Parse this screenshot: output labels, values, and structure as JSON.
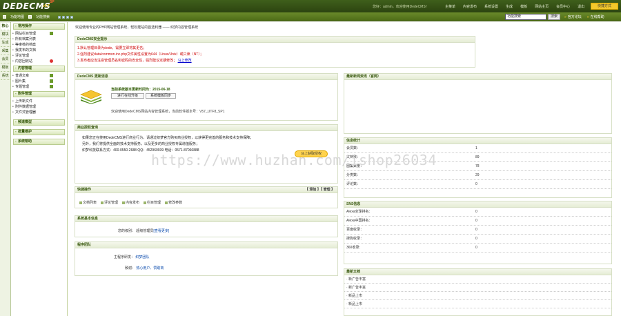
{
  "topbar": {
    "logo": "DEDECMS",
    "version": "v5.7",
    "badge": "SP",
    "welcome": "您好：admin，欢迎使用DedeCMS！",
    "nav": [
      "主菜单",
      "内容发布",
      "系统设置",
      "生成",
      "模板",
      "网站主页",
      "会员中心",
      "退出"
    ],
    "action_button": "快捷方式"
  },
  "bar2": {
    "links": [
      "功能地图",
      "功能搜索"
    ],
    "search_value": "功能搜索",
    "search_button": "搜索",
    "right_links": [
      {
        "mark": "»",
        "label": "官方论坛"
      },
      {
        "mark": "»",
        "label": "在线帮助"
      }
    ]
  },
  "lefttabs": [
    "核心",
    "模块",
    "生成",
    "采集",
    "会员",
    "模板",
    "系统"
  ],
  "sidebar": {
    "sections": [
      {
        "title": "常用操作",
        "items": [
          "网站栏目管理",
          "所有档案列表",
          "等审核的档案",
          "我发布的文档",
          "评论管理",
          "内容回收站"
        ]
      },
      {
        "title": "内容管理",
        "items": [
          "普通文章",
          "图片集",
          "专题管理"
        ]
      },
      {
        "title": "附件管理",
        "items": [
          "上传新文件",
          "附件数据管理",
          "文件式管理器"
        ]
      },
      {
        "title": "频道模型",
        "items": []
      },
      {
        "title": "批量维护",
        "items": []
      },
      {
        "title": "系统帮助",
        "items": []
      }
    ]
  },
  "main": {
    "header": "欢迎使用专业的PHP网站管理系统，轻松建站的首选利器 —— 织梦内容管理系统",
    "security": {
      "title": "DedeCMS安全提示",
      "lines": [
        "1.默认管理目录为dede，需要立即将其更名；",
        "2.强烈建议data/common.inc.php文件属性设置为644（Linux/Unix）或只读（NT）；",
        "3.发布者应当注意管理员名和密码的安全性，强烈建议定期修改；"
      ],
      "link": "马上修改"
    },
    "update": {
      "title": "DedeCMS 更新消息",
      "headline": "当前系统版本更新时间为：2015-06-18",
      "btn_check": "进行在线升级",
      "btn_sync": "系统模板同步",
      "note": "欢迎使用DedeCMS网站内容管理系统，当前软件版本号：V57_UTF8_SP1"
    },
    "license": {
      "title": "商业授权查询",
      "lines": [
        "如果您正在使用DedeCMS进行商业行为，请通过织梦官方购买商业授权，以获得更完善的服务和技术支持保障；",
        "另外，我们将提供全面的技术支持服务，以及更多的商业授权专属增值服务；",
        "织梦科技联系方式：400-0550-2688  QQ：452960939  电话：0571-87066888"
      ],
      "cta": "马上获取授权"
    },
    "quick": {
      "title": "快捷操作",
      "links_right": "【 添加 】【 管理 】",
      "items": [
        "文档列表",
        "评论管理",
        "内容发布",
        "栏目管理",
        "修改参数"
      ]
    },
    "sysinfo": {
      "title": "系统基本信息",
      "label": "您的级别：",
      "value": "超级管理员",
      "extra": "[查看更多]"
    },
    "team": {
      "title": "程序团队",
      "rows": [
        {
          "label": "主程序研发：",
          "value": "织梦团队"
        },
        {
          "label": "致谢：",
          "value": "热心用户、赞助商"
        }
      ]
    }
  },
  "right": {
    "news": {
      "title": "最新新闻资讯（官网）"
    },
    "stats": {
      "title": "信息统计",
      "rows": [
        {
          "label": "会员数：",
          "value": "1"
        },
        {
          "label": "文档数：",
          "value": "89"
        },
        {
          "label": "图集数量：",
          "value": "78"
        },
        {
          "label": "分类数：",
          "value": "29"
        },
        {
          "label": "评论数：",
          "value": "0"
        }
      ]
    },
    "sns": {
      "title": "SNS信息",
      "rows": [
        {
          "label": "Alexa全球排名：",
          "value": "0"
        },
        {
          "label": "Alexa中国排名：",
          "value": "0"
        },
        {
          "label": "百度收录：",
          "value": "0"
        },
        {
          "label": "搜狗收录：",
          "value": "0"
        },
        {
          "label": "360收录：",
          "value": "0"
        }
      ]
    },
    "docs": {
      "title": "最新文档",
      "rows": [
        "· 新广告丰富",
        "· 新广告丰富",
        "· 新品上市",
        "· 新品上市"
      ]
    }
  },
  "watermark": "https://www.huzhan.com/ishop26034"
}
